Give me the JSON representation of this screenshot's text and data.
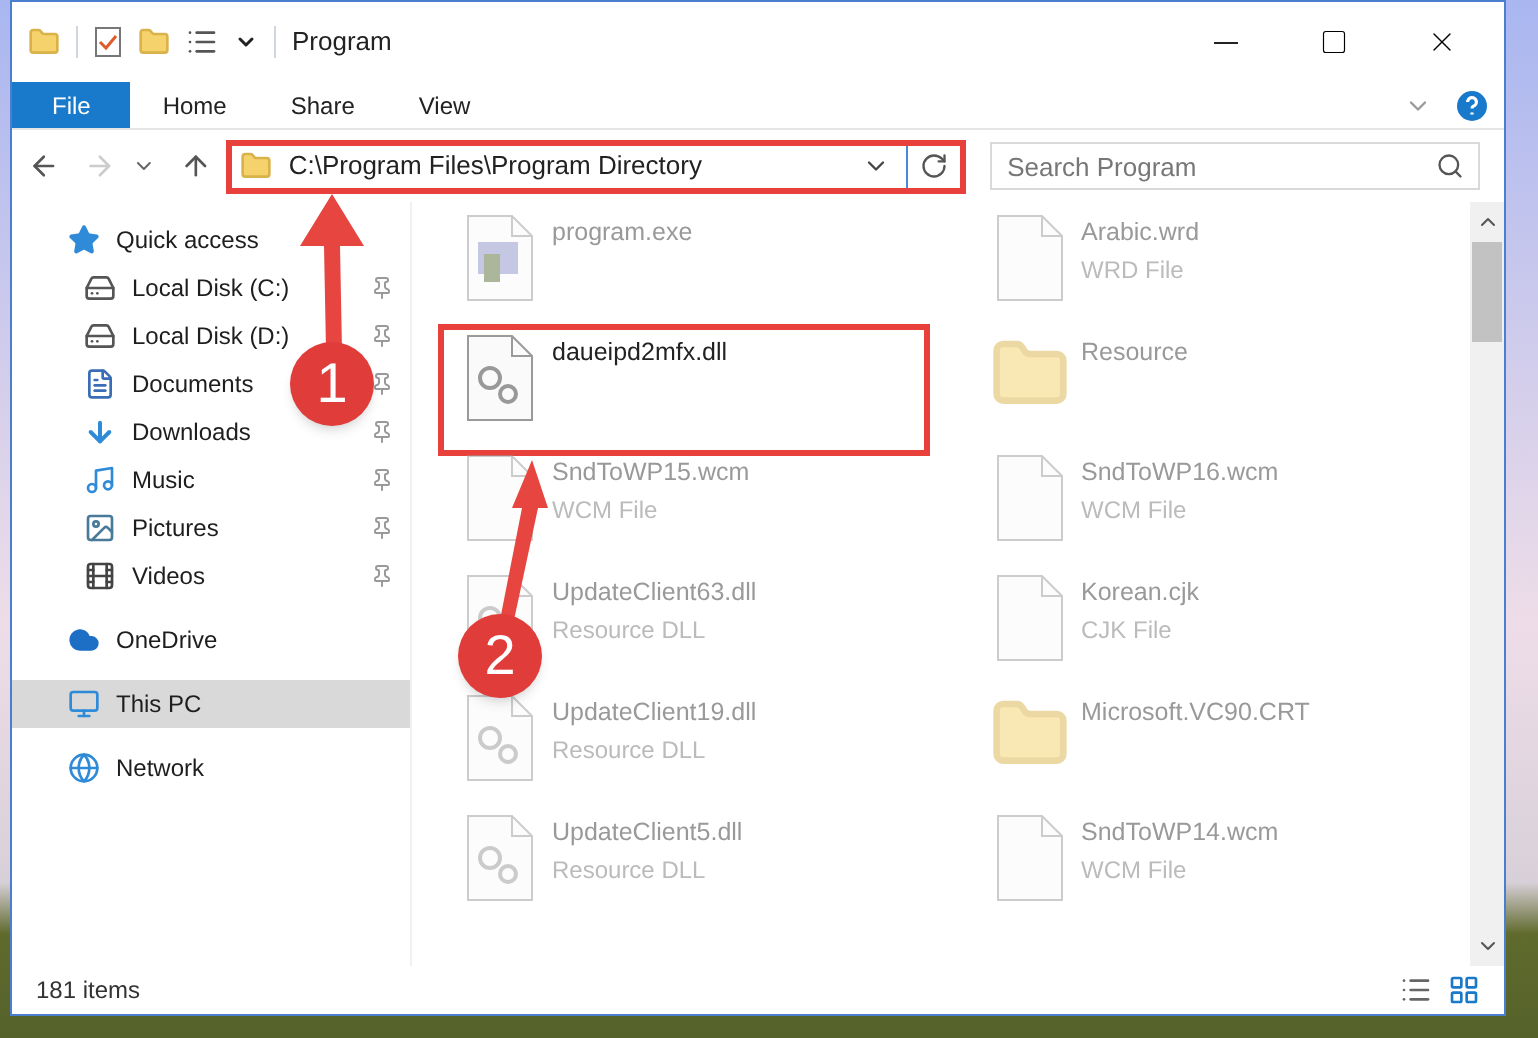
{
  "window": {
    "title": "Program"
  },
  "ribbon_tabs": [
    {
      "label": "File",
      "kind": "file"
    },
    {
      "label": "Home",
      "kind": "tab"
    },
    {
      "label": "Share",
      "kind": "tab"
    },
    {
      "label": "View",
      "kind": "tab"
    }
  ],
  "address": {
    "path": "C:\\Program Files\\Program Directory",
    "highlighted": true
  },
  "search": {
    "placeholder": "Search Program"
  },
  "sidebar": {
    "items": [
      {
        "label": "Quick access",
        "kind": "star",
        "selected": false,
        "children": [
          {
            "label": "Local Disk (C:)",
            "kind": "osdrive",
            "pinned": true,
            "selected": false
          },
          {
            "label": "Local Disk (D:)",
            "kind": "drive",
            "pinned": true,
            "selected": false
          },
          {
            "label": "Documents",
            "kind": "documents",
            "pinned": true,
            "selected": false
          },
          {
            "label": "Downloads",
            "kind": "downloads",
            "pinned": true,
            "selected": false
          },
          {
            "label": "Music",
            "kind": "music",
            "pinned": true,
            "selected": false
          },
          {
            "label": "Pictures",
            "kind": "pictures",
            "pinned": true,
            "selected": false
          },
          {
            "label": "Videos",
            "kind": "videos",
            "pinned": true,
            "selected": false
          }
        ]
      },
      {
        "label": "OneDrive",
        "kind": "cloud",
        "selected": false
      },
      {
        "label": "This PC",
        "kind": "pc",
        "selected": true
      },
      {
        "label": "Network",
        "kind": "network",
        "selected": false
      }
    ]
  },
  "files": [
    {
      "name": "program.exe",
      "kind": "exe",
      "highlighted": false
    },
    {
      "name": "Arabic.wrd",
      "type": "WRD File",
      "kind": "file",
      "highlighted": false
    },
    {
      "name": "daueipd2mfx.dll",
      "kind": "dll",
      "highlighted": true
    },
    {
      "name": "Resource",
      "kind": "zipfolder",
      "highlighted": false
    },
    {
      "name": "SndToWP15.wcm",
      "type": "WCM File",
      "kind": "file",
      "highlighted": false
    },
    {
      "name": "SndToWP16.wcm",
      "type": "WCM File",
      "kind": "file",
      "highlighted": false
    },
    {
      "name": "UpdateClient63.dll",
      "type": "Resource DLL",
      "kind": "dll",
      "highlighted": false
    },
    {
      "name": "Korean.cjk",
      "type": "CJK File",
      "kind": "file",
      "highlighted": false
    },
    {
      "name": "UpdateClient19.dll",
      "type": "Resource DLL",
      "kind": "dll",
      "highlighted": false
    },
    {
      "name": "Microsoft.VC90.CRT",
      "kind": "zipfolder",
      "highlighted": false
    },
    {
      "name": "UpdateClient5.dll",
      "type": "Resource DLL",
      "kind": "dll",
      "highlighted": false
    },
    {
      "name": "SndToWP14.wcm",
      "type": "WCM File",
      "kind": "file",
      "highlighted": false
    }
  ],
  "callouts": [
    {
      "number": "1"
    },
    {
      "number": "2"
    }
  ],
  "status_bar": {
    "count": "181 items"
  }
}
